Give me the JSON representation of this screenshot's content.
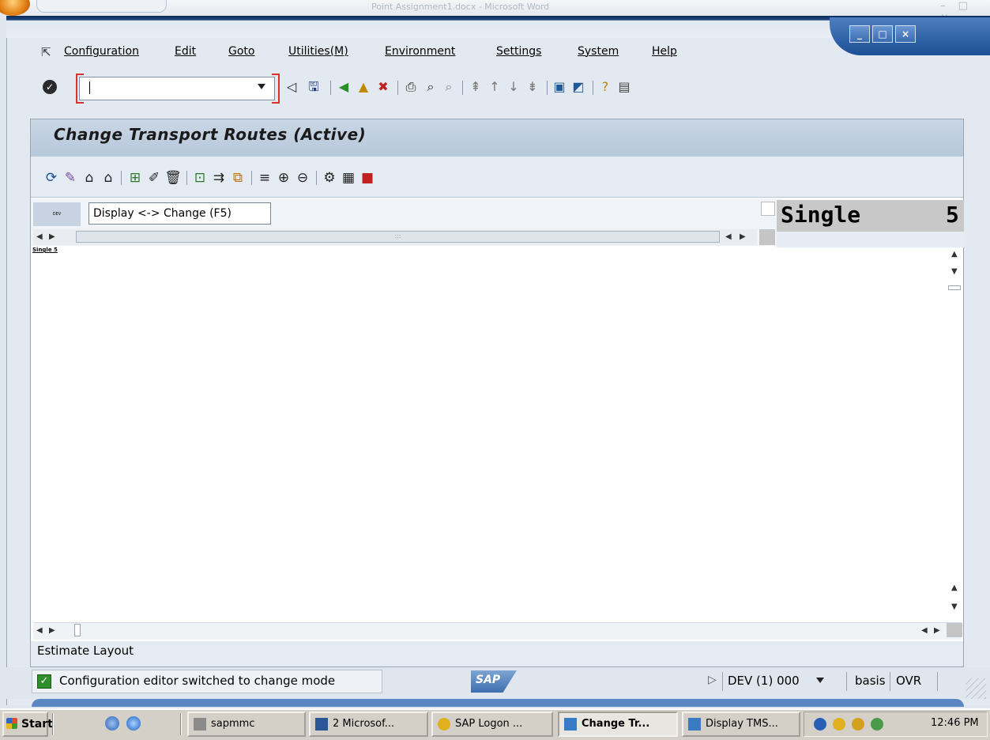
{
  "office": {
    "title": "Point Assignment1.docx - Microsoft Word"
  },
  "window": {
    "minimize": "_",
    "maximize": "□",
    "close": "×"
  },
  "menu": [
    {
      "label": "Configuration"
    },
    {
      "label": "Edit"
    },
    {
      "label": "Goto"
    },
    {
      "label": "Utilities(M)"
    },
    {
      "label": "Environment"
    },
    {
      "label": "Settings"
    },
    {
      "label": "System"
    },
    {
      "label": "Help"
    }
  ],
  "command_field": {
    "value": ""
  },
  "panel": {
    "title": "Change Transport Routes (Active)"
  },
  "overview": {
    "tooltip": "Display <-> Change   (F5)",
    "mini_label": "DEV",
    "single_label": "Single",
    "single_num": "5",
    "tiny_single": "Single  5"
  },
  "estimate": "Estimate Layout",
  "status": {
    "message": "Configuration editor switched to change mode",
    "system": "DEV (1) 000",
    "user": "basis",
    "mode": "OVR",
    "sap_logo": "SAP"
  },
  "taskbar": {
    "start": "Start",
    "items": [
      {
        "label": "sapmmc"
      },
      {
        "label": "2 Microsof..."
      },
      {
        "label": "SAP Logon ..."
      },
      {
        "label": "Change Tr..."
      },
      {
        "label": "Display TMS..."
      }
    ],
    "clock": "12:46 PM"
  }
}
